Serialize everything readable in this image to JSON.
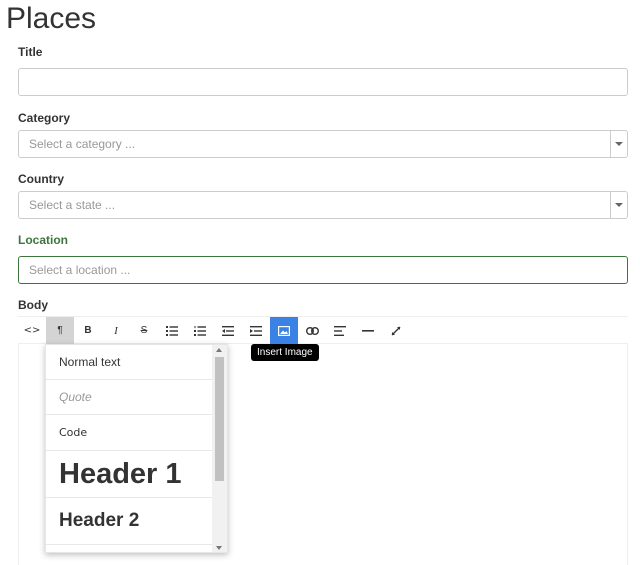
{
  "page": {
    "title": "Places"
  },
  "form": {
    "title_label": "Title",
    "title_value": "",
    "category_label": "Category",
    "category_placeholder": "Select a category ...",
    "country_label": "Country",
    "country_placeholder": "Select a state ...",
    "location_label": "Location",
    "location_placeholder": "Select a location ...",
    "body_label": "Body"
  },
  "editor": {
    "toolbar": [
      {
        "name": "code-view-icon",
        "glyph": "<>"
      },
      {
        "name": "paragraph-style-icon",
        "glyph": "¶",
        "state": "active"
      },
      {
        "name": "bold-icon",
        "glyph": "B"
      },
      {
        "name": "italic-icon",
        "glyph": "I"
      },
      {
        "name": "strikethrough-icon",
        "glyph": "S"
      },
      {
        "name": "unordered-list-icon",
        "glyph": "ul"
      },
      {
        "name": "ordered-list-icon",
        "glyph": "ol"
      },
      {
        "name": "outdent-icon",
        "glyph": "outdent"
      },
      {
        "name": "indent-icon",
        "glyph": "indent"
      },
      {
        "name": "insert-image-icon",
        "glyph": "image",
        "state": "highlighted"
      },
      {
        "name": "link-icon",
        "glyph": "link"
      },
      {
        "name": "align-icon",
        "glyph": "align"
      },
      {
        "name": "horizontal-rule-icon",
        "glyph": "hr"
      },
      {
        "name": "fullscreen-icon",
        "glyph": "expand"
      }
    ],
    "tooltip": "Insert Image",
    "format_menu": [
      {
        "label": "Normal text",
        "style": "normal"
      },
      {
        "label": "Quote",
        "style": "quote"
      },
      {
        "label": "Code",
        "style": "code"
      },
      {
        "label": "Header 1",
        "style": "h1"
      },
      {
        "label": "Header 2",
        "style": "h2"
      }
    ]
  },
  "colors": {
    "success": "#3c763d",
    "primary": "#3a82e4",
    "border": "#cccccc"
  }
}
